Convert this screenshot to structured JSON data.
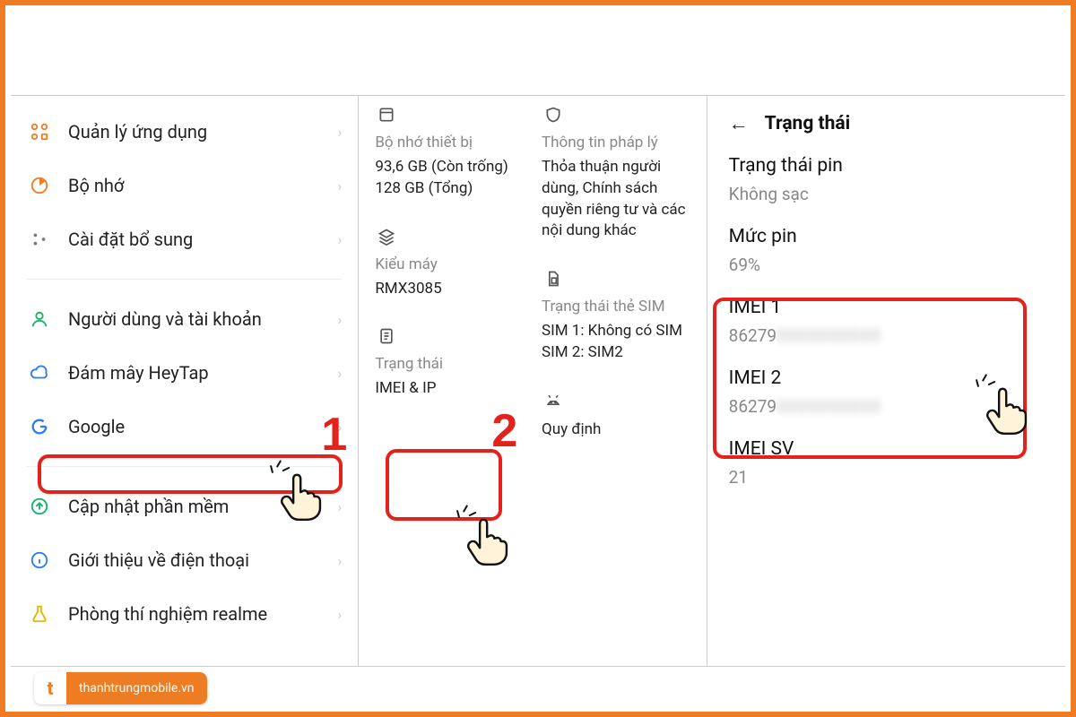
{
  "annotations": {
    "step1": "1",
    "step2": "2"
  },
  "badge": {
    "text": "thanhtrungmobile.vn"
  },
  "panel1": {
    "items": [
      {
        "key": "apps",
        "icon": "grid",
        "iconColor": "#ee7c22",
        "label": "Quản lý ứng dụng"
      },
      {
        "key": "memory",
        "icon": "pie",
        "iconColor": "#ee7c22",
        "label": "Bộ nhớ"
      },
      {
        "key": "extra",
        "icon": "dots",
        "iconColor": "#777",
        "label": "Cài đặt bổ sung"
      }
    ],
    "items2": [
      {
        "key": "users",
        "icon": "user",
        "iconColor": "#13b36b",
        "label": "Người dùng và tài khoản"
      },
      {
        "key": "heytap",
        "icon": "cloud",
        "iconColor": "#2a7cf0",
        "label": "Đám mây HeyTap"
      },
      {
        "key": "google",
        "icon": "g",
        "iconColor": "#2a7cf0",
        "label": "Google"
      }
    ],
    "items3": [
      {
        "key": "update",
        "icon": "up",
        "iconColor": "#13b36b",
        "label": "Cập nhật phần mềm"
      },
      {
        "key": "about",
        "icon": "info",
        "iconColor": "#2a7cf0",
        "label": "Giới thiệu về điện thoại",
        "highlight": true
      },
      {
        "key": "lab",
        "icon": "flask",
        "iconColor": "#e9b400",
        "label": "Phòng thí nghiệm realme"
      }
    ]
  },
  "panel2": {
    "left": [
      {
        "key": "storage",
        "icon": "disk",
        "title": "Bộ nhớ thiết bị",
        "value": "93,6 GB (Còn trống)\n128 GB (Tổng)"
      },
      {
        "key": "model",
        "icon": "layers",
        "title": "Kiểu máy",
        "value": "RMX3085"
      },
      {
        "key": "status",
        "icon": "doc",
        "title": "Trạng thái",
        "value": "IMEI & IP",
        "highlight": true
      }
    ],
    "right": [
      {
        "key": "legal",
        "icon": "shield",
        "title": "Thông tin pháp lý",
        "value": "Thỏa thuận người dùng, Chính sách quyền riêng tư và các nội dung khác"
      },
      {
        "key": "sim",
        "icon": "sim",
        "title": "Trạng thái thẻ SIM",
        "value": "SIM 1: Không có SIM\nSIM 2: SIM2"
      },
      {
        "key": "reg",
        "icon": "android",
        "title": "",
        "value": "Quy định"
      }
    ]
  },
  "panel3": {
    "title": "Trạng thái",
    "batteryStateLabel": "Trạng thái pin",
    "batteryStateValue": "Không sạc",
    "batteryLevelLabel": "Mức pin",
    "batteryLevelValue": "69%",
    "imei1Label": "IMEI 1",
    "imei1Prefix": "86279",
    "imei2Label": "IMEI 2",
    "imei2Prefix": "86279",
    "imeiSvLabel": "IMEI SV",
    "imeiSvValue": "21"
  }
}
